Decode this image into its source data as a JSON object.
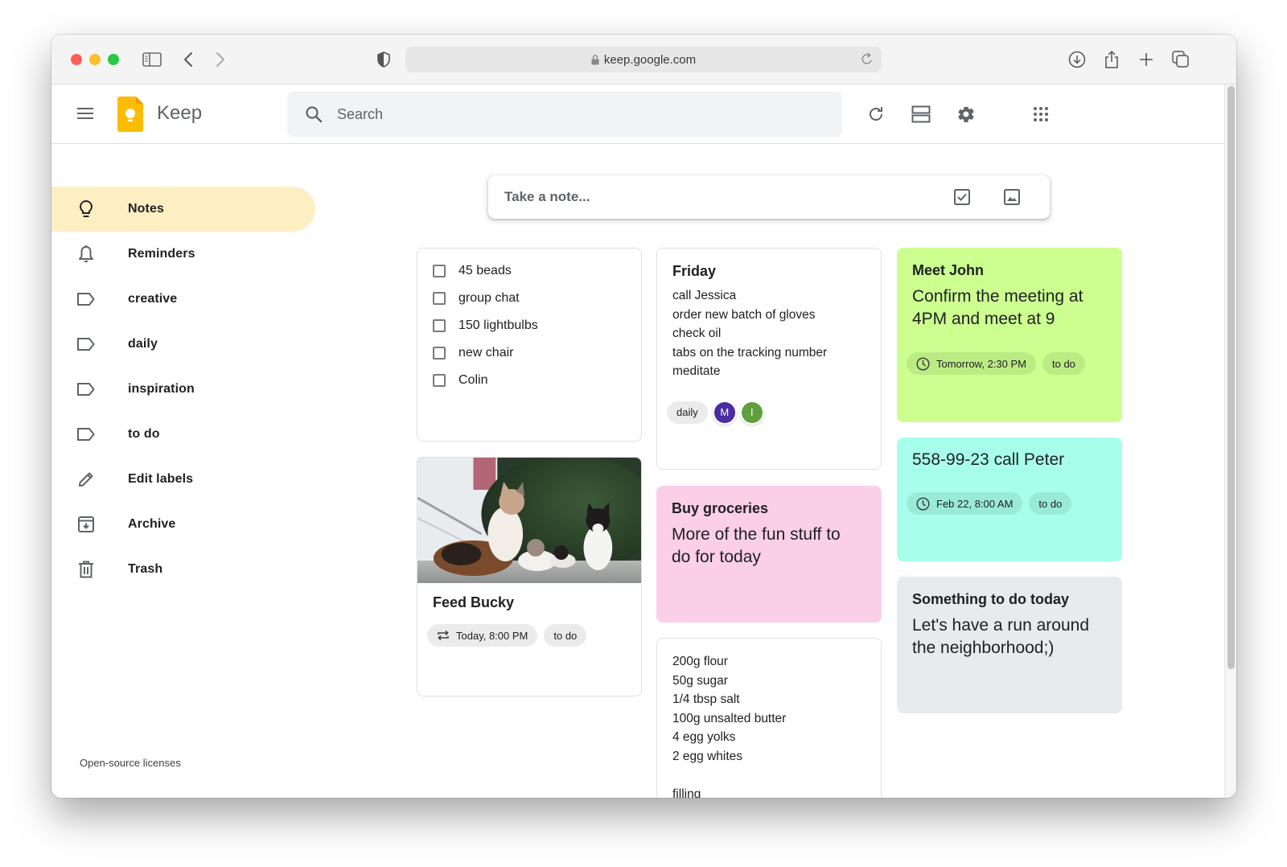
{
  "browser": {
    "url": "keep.google.com"
  },
  "app": {
    "brand": "Keep",
    "search_placeholder": "Search"
  },
  "sidebar": {
    "items": [
      {
        "label": "Notes",
        "icon": "lightbulb-icon",
        "active": true
      },
      {
        "label": "Reminders",
        "icon": "bell-icon"
      },
      {
        "label": "creative",
        "icon": "label-icon"
      },
      {
        "label": "daily",
        "icon": "label-icon"
      },
      {
        "label": "inspiration",
        "icon": "label-icon"
      },
      {
        "label": "to do",
        "icon": "label-icon"
      },
      {
        "label": "Edit labels",
        "icon": "pencil-icon"
      },
      {
        "label": "Archive",
        "icon": "archive-icon"
      },
      {
        "label": "Trash",
        "icon": "trash-icon"
      }
    ],
    "footer_link": "Open-source licenses"
  },
  "take_note": {
    "placeholder": "Take a note..."
  },
  "notes": {
    "checklist": {
      "items": [
        "45 beads",
        "group chat",
        "150 lightbulbs",
        "new chair",
        "Colin"
      ]
    },
    "feed_bucky": {
      "title": "Feed Bucky",
      "image_alt": "Cats sitting on pavement",
      "reminder": "Today, 8:00 PM",
      "label": "to do"
    },
    "friday": {
      "title": "Friday",
      "lines": [
        "call Jessica",
        "order new batch of gloves",
        "check oil",
        "tabs on the tracking number",
        "meditate"
      ],
      "label": "daily",
      "collaborators": [
        {
          "initial": "M",
          "color": "#4a2ba0"
        },
        {
          "initial": "I",
          "color": "#5f9f3d"
        }
      ]
    },
    "groceries": {
      "title": "Buy groceries",
      "body": "More of the fun stuff to do for today",
      "color": "#fbcfe8"
    },
    "recipe": {
      "lines": [
        "200g flour",
        "50g sugar",
        "1/4 tbsp salt",
        "100g unsalted butter",
        "4 egg yolks",
        "2 egg whites",
        "",
        "filling"
      ]
    },
    "meet_john": {
      "title": "Meet John",
      "body": "Confirm the meeting at 4PM and meet at 9",
      "reminder": "Tomorrow, 2:30 PM",
      "label": "to do",
      "color": "#ccff90"
    },
    "call_peter": {
      "title": "558-99-23 call Peter",
      "reminder": "Feb 22, 8:00 AM",
      "label": "to do",
      "color": "#a7ffeb"
    },
    "something": {
      "title": "Something to do today",
      "body": "Let's have a run around the neighborhood;)",
      "color": "#e8eaed"
    }
  },
  "colors": {
    "active_nav": "#feefc3",
    "keep_yellow": "#fbbc04"
  }
}
